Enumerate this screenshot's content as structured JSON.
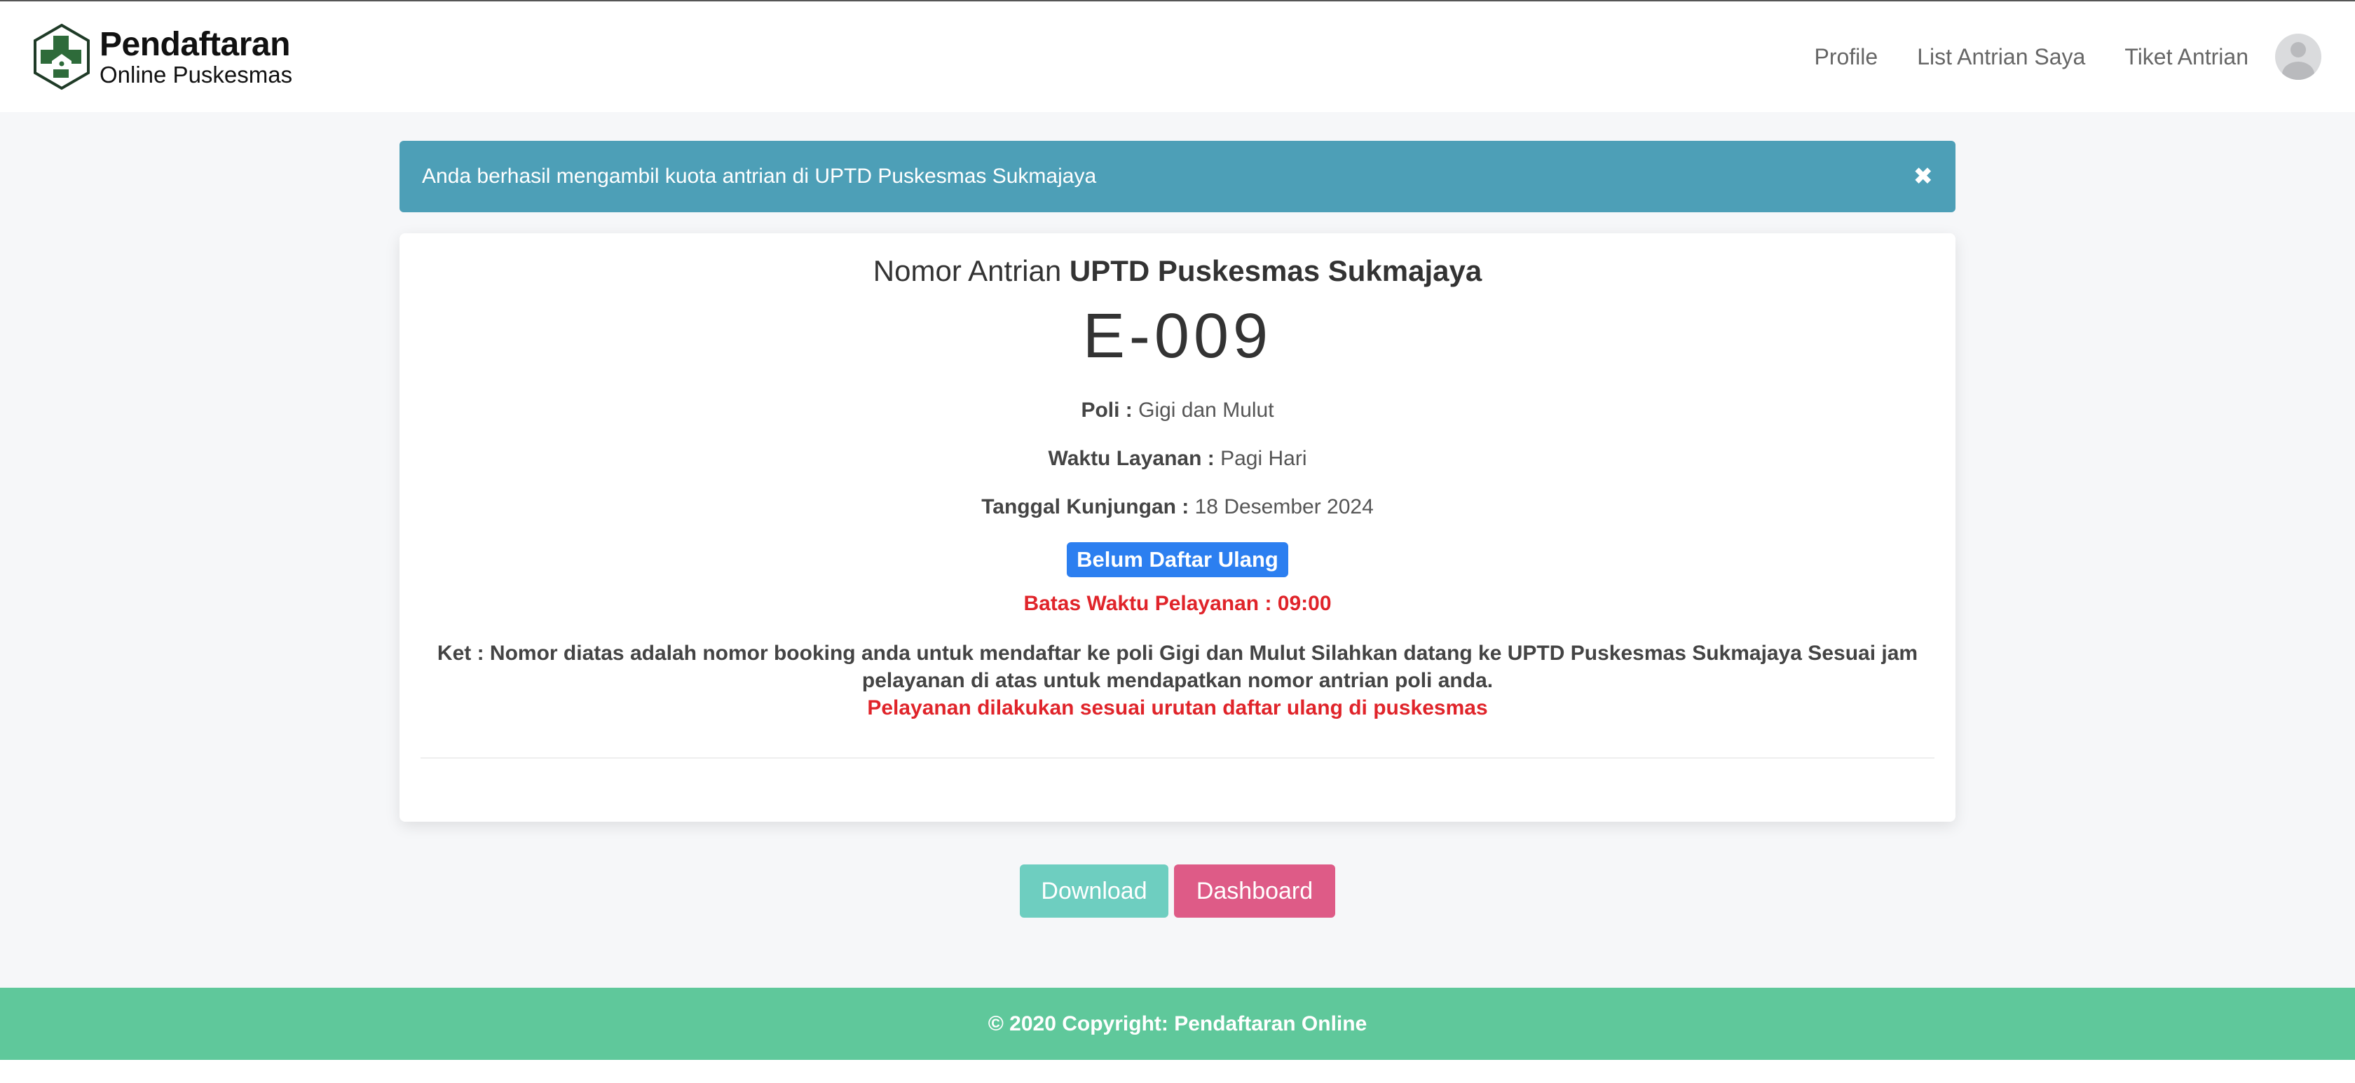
{
  "navbar": {
    "brand_title": "Pendaftaran",
    "brand_subtitle": "Online Puskesmas",
    "links": [
      "Profile",
      "List Antrian Saya",
      "Tiket Antrian"
    ]
  },
  "alert": {
    "message": "Anda berhasil mengambil kuota antrian di UPTD Puskesmas Sukmajaya",
    "close_glyph": "✖"
  },
  "ticket": {
    "title_prefix": "Nomor Antrian",
    "location": "UPTD Puskesmas Sukmajaya",
    "number": "E-009",
    "poli_label": "Poli :",
    "poli_value": "Gigi dan Mulut",
    "waktu_label": "Waktu Layanan :",
    "waktu_value": "Pagi Hari",
    "tanggal_label": "Tanggal Kunjungan :",
    "tanggal_value": "18 Desember 2024",
    "status_badge": "Belum Daftar Ulang",
    "batas_waktu": "Batas Waktu Pelayanan : 09:00",
    "ket_text": "Ket : Nomor diatas adalah nomor booking anda untuk mendaftar ke poli Gigi dan Mulut Silahkan datang ke UPTD Puskesmas Sukmajaya Sesuai jam pelayanan di atas untuk mendapatkan nomor antrian poli anda.",
    "ket_note": "Pelayanan dilakukan sesuai urutan daftar ulang di puskesmas"
  },
  "buttons": {
    "download": "Download",
    "dashboard": "Dashboard"
  },
  "footer": {
    "copyright": "© 2020 Copyright: Pendaftaran Online"
  },
  "colors": {
    "alert_bg": "#4d9fb7",
    "badge_bg": "#2c7ff0",
    "warning_text": "#e0242a",
    "download_btn": "#6ecec0",
    "dashboard_btn": "#de5b87",
    "footer_bg": "#5fc89b",
    "logo_green": "#2e6b3a"
  },
  "icons": {
    "logo": "hexagon-cross-logo-icon",
    "alert_close": "close-icon",
    "avatar": "user-avatar-icon"
  }
}
